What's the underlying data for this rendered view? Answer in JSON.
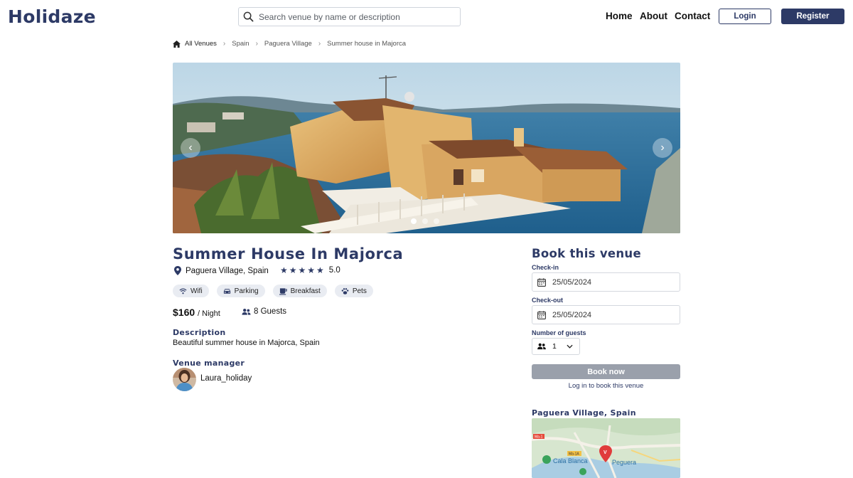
{
  "header": {
    "logo": "Holidaze",
    "search_placeholder": "Search venue by name or description",
    "nav": [
      "Home",
      "About",
      "Contact"
    ],
    "login": "Login",
    "register": "Register"
  },
  "breadcrumb": [
    "All Venues",
    "Spain",
    "Paguera Village",
    "Summer house in Majorca"
  ],
  "venue": {
    "title": "Summer House In Majorca",
    "location": "Paguera Village, Spain",
    "stars": "★★★★★",
    "rating": "5.0",
    "amenities": [
      "Wifi",
      "Parking",
      "Breakfast",
      "Pets"
    ],
    "price": "$160",
    "price_unit": "/ Night",
    "guests": "8 Guests",
    "description_label": "Description",
    "description": "Beautiful summer house in Majorca, Spain",
    "manager_label": "Venue manager",
    "manager_name": "Laura_holiday"
  },
  "carousel": {
    "slides": 3,
    "active": 1
  },
  "booking": {
    "title": "Book this venue",
    "checkin_label": "Check-in",
    "checkin_value": "25/05/2024",
    "checkout_label": "Check-out",
    "checkout_value": "25/05/2024",
    "guests_label": "Number of guests",
    "guests_value": "1",
    "book_button": "Book now",
    "login_note": "Log in to book this venue"
  },
  "map": {
    "title": "Paguera Village, Spain",
    "labels": [
      "Ma-1",
      "Ma-1A",
      "Cala Blanca",
      "Peguera"
    ]
  },
  "colors": {
    "brand": "#2d3a66",
    "disabled_button": "#9aa0ab",
    "chip_bg": "#e9ecf2"
  }
}
